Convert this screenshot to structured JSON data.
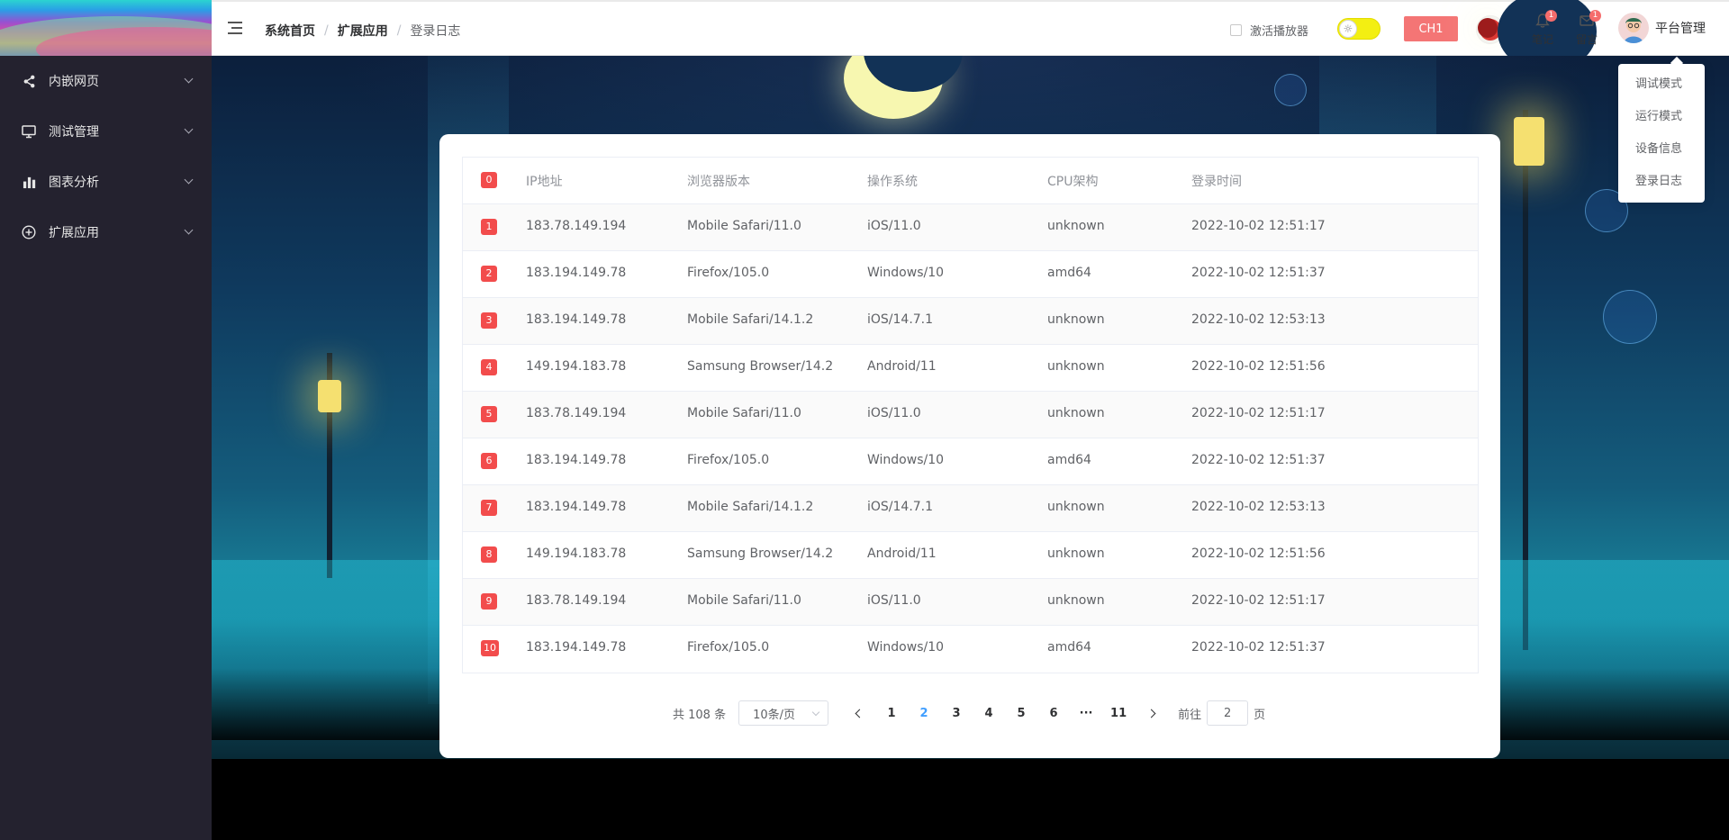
{
  "sidebar": {
    "items": [
      {
        "label": "内嵌网页",
        "icon": "share-icon"
      },
      {
        "label": "测试管理",
        "icon": "monitor-icon"
      },
      {
        "label": "图表分析",
        "icon": "bar-chart-icon"
      },
      {
        "label": "扩展应用",
        "icon": "plus-circle-icon"
      }
    ]
  },
  "header": {
    "breadcrumb": [
      "系统首页",
      "扩展应用",
      "登录日志"
    ],
    "player_label": "激活播放器",
    "channel_button": "CH1",
    "notes": {
      "label": "笔记",
      "badge": "1"
    },
    "messages": {
      "label": "留言",
      "badge": "1"
    },
    "user_name": "平台管理"
  },
  "dropdown": {
    "items": [
      "调试模式",
      "运行模式",
      "设备信息",
      "登录日志"
    ]
  },
  "table": {
    "headers": {
      "index": "0",
      "ip": "IP地址",
      "browser": "浏览器版本",
      "os": "操作系统",
      "cpu": "CPU架构",
      "time": "登录时间"
    },
    "rows": [
      {
        "index": "1",
        "ip": "183.78.149.194",
        "browser": "Mobile Safari/11.0",
        "os": "iOS/11.0",
        "cpu": "unknown",
        "time": "2022-10-02 12:51:17"
      },
      {
        "index": "2",
        "ip": "183.194.149.78",
        "browser": "Firefox/105.0",
        "os": "Windows/10",
        "cpu": "amd64",
        "time": "2022-10-02 12:51:37"
      },
      {
        "index": "3",
        "ip": "183.194.149.78",
        "browser": "Mobile Safari/14.1.2",
        "os": "iOS/14.7.1",
        "cpu": "unknown",
        "time": "2022-10-02 12:53:13"
      },
      {
        "index": "4",
        "ip": "149.194.183.78",
        "browser": "Samsung Browser/14.2",
        "os": "Android/11",
        "cpu": "unknown",
        "time": "2022-10-02 12:51:56"
      },
      {
        "index": "5",
        "ip": "183.78.149.194",
        "browser": "Mobile Safari/11.0",
        "os": "iOS/11.0",
        "cpu": "unknown",
        "time": "2022-10-02 12:51:17"
      },
      {
        "index": "6",
        "ip": "183.194.149.78",
        "browser": "Firefox/105.0",
        "os": "Windows/10",
        "cpu": "amd64",
        "time": "2022-10-02 12:51:37"
      },
      {
        "index": "7",
        "ip": "183.194.149.78",
        "browser": "Mobile Safari/14.1.2",
        "os": "iOS/14.7.1",
        "cpu": "unknown",
        "time": "2022-10-02 12:53:13"
      },
      {
        "index": "8",
        "ip": "149.194.183.78",
        "browser": "Samsung Browser/14.2",
        "os": "Android/11",
        "cpu": "unknown",
        "time": "2022-10-02 12:51:56"
      },
      {
        "index": "9",
        "ip": "183.78.149.194",
        "browser": "Mobile Safari/11.0",
        "os": "iOS/11.0",
        "cpu": "unknown",
        "time": "2022-10-02 12:51:17"
      },
      {
        "index": "10",
        "ip": "183.194.149.78",
        "browser": "Firefox/105.0",
        "os": "Windows/10",
        "cpu": "amd64",
        "time": "2022-10-02 12:51:37"
      }
    ]
  },
  "pagination": {
    "total_text": "共 108 条",
    "page_size": "10条/页",
    "pages": [
      "1",
      "2",
      "3",
      "4",
      "5",
      "6",
      "···",
      "11"
    ],
    "current_page": "2",
    "jump_prefix": "前往",
    "jump_value": "2",
    "jump_suffix": "页"
  },
  "colors": {
    "sidebar_bg": "#24222f",
    "badge_red": "#f24c4c",
    "channel_button": "#f47575",
    "active_page": "#409eff",
    "toggle_yellow": "#f3ef12"
  }
}
